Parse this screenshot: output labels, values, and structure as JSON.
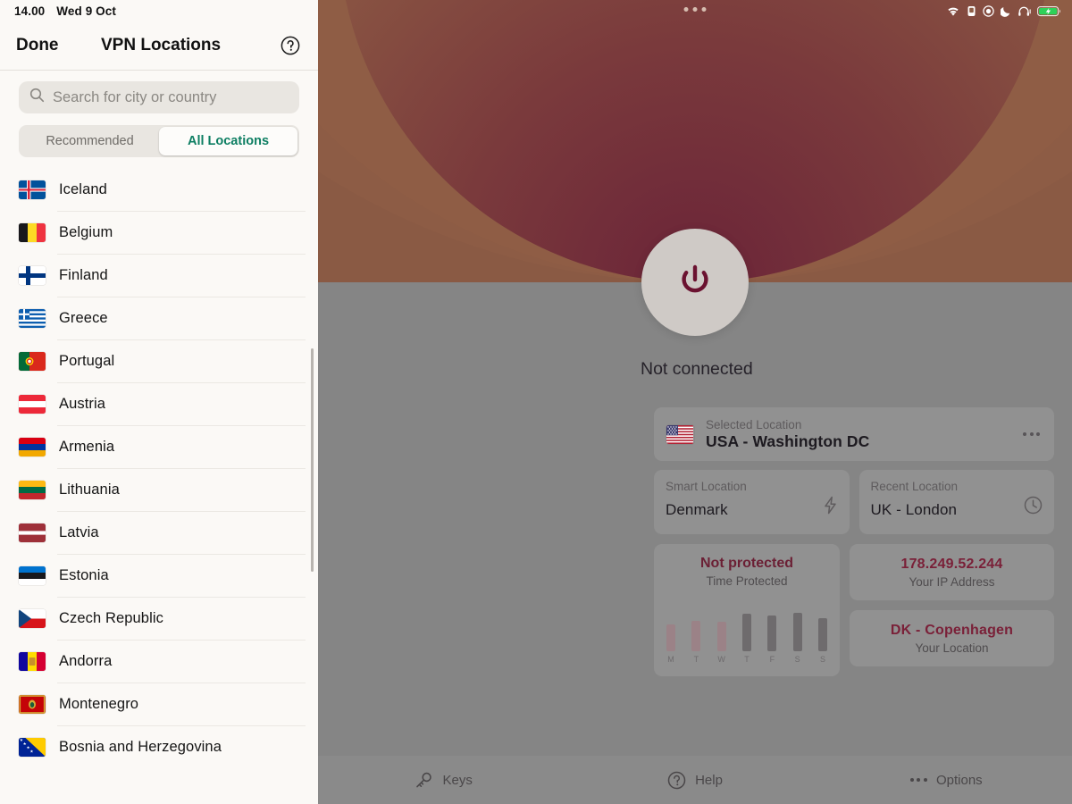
{
  "status_bar": {
    "time": "14.00",
    "date": "Wed 9 Oct",
    "icons": [
      "wifi-icon",
      "alarm-icon",
      "record-icon",
      "moon-icon",
      "headphones-icon",
      "battery-charging-icon"
    ]
  },
  "left_panel": {
    "nav": {
      "done_label": "Done",
      "title": "VPN Locations",
      "help_icon": "question-circle-icon"
    },
    "search": {
      "placeholder": "Search for city or country",
      "value": "",
      "icon": "search-icon"
    },
    "segmented": {
      "options": [
        "Recommended",
        "All Locations"
      ],
      "selected": "All Locations",
      "active_color": "#0d7e62"
    },
    "countries": [
      {
        "name": "Iceland",
        "flag": "is"
      },
      {
        "name": "Belgium",
        "flag": "be"
      },
      {
        "name": "Finland",
        "flag": "fi"
      },
      {
        "name": "Greece",
        "flag": "gr"
      },
      {
        "name": "Portugal",
        "flag": "pt"
      },
      {
        "name": "Austria",
        "flag": "at"
      },
      {
        "name": "Armenia",
        "flag": "am"
      },
      {
        "name": "Lithuania",
        "flag": "lt"
      },
      {
        "name": "Latvia",
        "flag": "lv"
      },
      {
        "name": "Estonia",
        "flag": "ee"
      },
      {
        "name": "Czech Republic",
        "flag": "cz"
      },
      {
        "name": "Andorra",
        "flag": "ad"
      },
      {
        "name": "Montenegro",
        "flag": "me"
      },
      {
        "name": "Bosnia and Herzegovina",
        "flag": "ba"
      }
    ]
  },
  "right_panel": {
    "connection": {
      "status": "Not connected",
      "power_icon": "power-icon",
      "power_color": "#6b1230"
    },
    "selected_location": {
      "label": "Selected Location",
      "value": "USA - Washington DC",
      "flag": "us",
      "menu_icon": "ellipsis-icon"
    },
    "smart_location": {
      "label": "Smart Location",
      "value": "Denmark",
      "icon": "bolt-icon"
    },
    "recent_location": {
      "label": "Recent Location",
      "value": "UK - London",
      "icon": "clock-icon"
    },
    "time_protected": {
      "title": "Not protected",
      "subtitle": "Time Protected",
      "title_color": "#6b1f34"
    },
    "ip_address": {
      "value": "178.249.52.244",
      "label": "Your IP Address",
      "value_color": "#7a2038"
    },
    "your_location": {
      "value": "DK - Copenhagen",
      "label": "Your Location",
      "value_color": "#7a2038"
    },
    "toolbar": [
      {
        "label": "Keys",
        "icon": "key-icon"
      },
      {
        "label": "Help",
        "icon": "question-circle-icon"
      },
      {
        "label": "Options",
        "icon": "ellipsis-icon"
      }
    ]
  },
  "chart_data": {
    "type": "bar",
    "title": "Time Protected",
    "categories": [
      "M",
      "T",
      "W",
      "T",
      "F",
      "S",
      "S"
    ],
    "values": [
      40,
      46,
      44,
      56,
      54,
      58,
      50
    ],
    "colors": [
      "#9b8287",
      "#9b8287",
      "#9b8287",
      "#6e6b6d",
      "#6e6b6d",
      "#6e6b6d",
      "#6e6b6d"
    ],
    "xlabel": "",
    "ylabel": "",
    "ylim": [
      0,
      70
    ],
    "grid": false,
    "legend": false
  }
}
